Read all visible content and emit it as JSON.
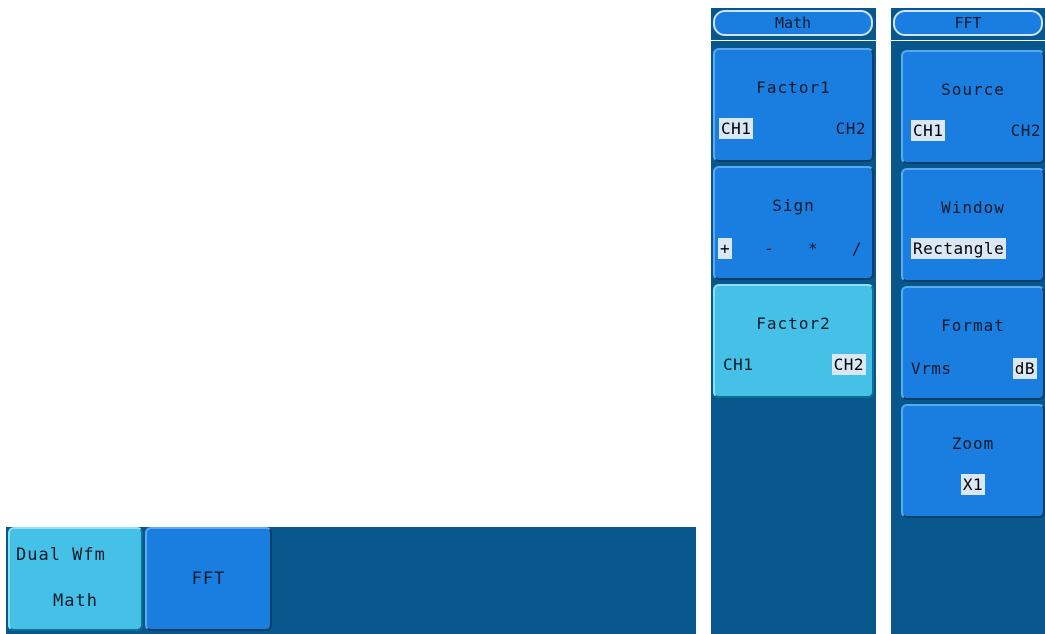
{
  "bottom_menu": {
    "dual_wfm_math": {
      "line1": "Dual Wfm",
      "line2": "Math"
    },
    "fft": "FFT"
  },
  "math_menu": {
    "header": "Math",
    "factor1": {
      "title": "Factor1",
      "options": [
        "CH1",
        "CH2"
      ],
      "selected": "CH1"
    },
    "sign": {
      "title": "Sign",
      "options": [
        "+",
        "-",
        "*",
        "/"
      ],
      "selected": "+"
    },
    "factor2": {
      "title": "Factor2",
      "options": [
        "CH1",
        "CH2"
      ],
      "selected": "CH2"
    }
  },
  "fft_menu": {
    "header": "FFT",
    "source": {
      "title": "Source",
      "options": [
        "CH1",
        "CH2"
      ],
      "selected": "CH1"
    },
    "window": {
      "title": "Window",
      "value": "Rectangle"
    },
    "format": {
      "title": "Format",
      "options": [
        "Vrms",
        "dB"
      ],
      "selected": "dB"
    },
    "zoom": {
      "title": "Zoom",
      "value": "X1"
    }
  },
  "colors": {
    "panel_bg": "#08578c",
    "button": "#1a7de0",
    "button_active": "#45c0e6",
    "selected_option_bg": "#d9e8f4"
  }
}
